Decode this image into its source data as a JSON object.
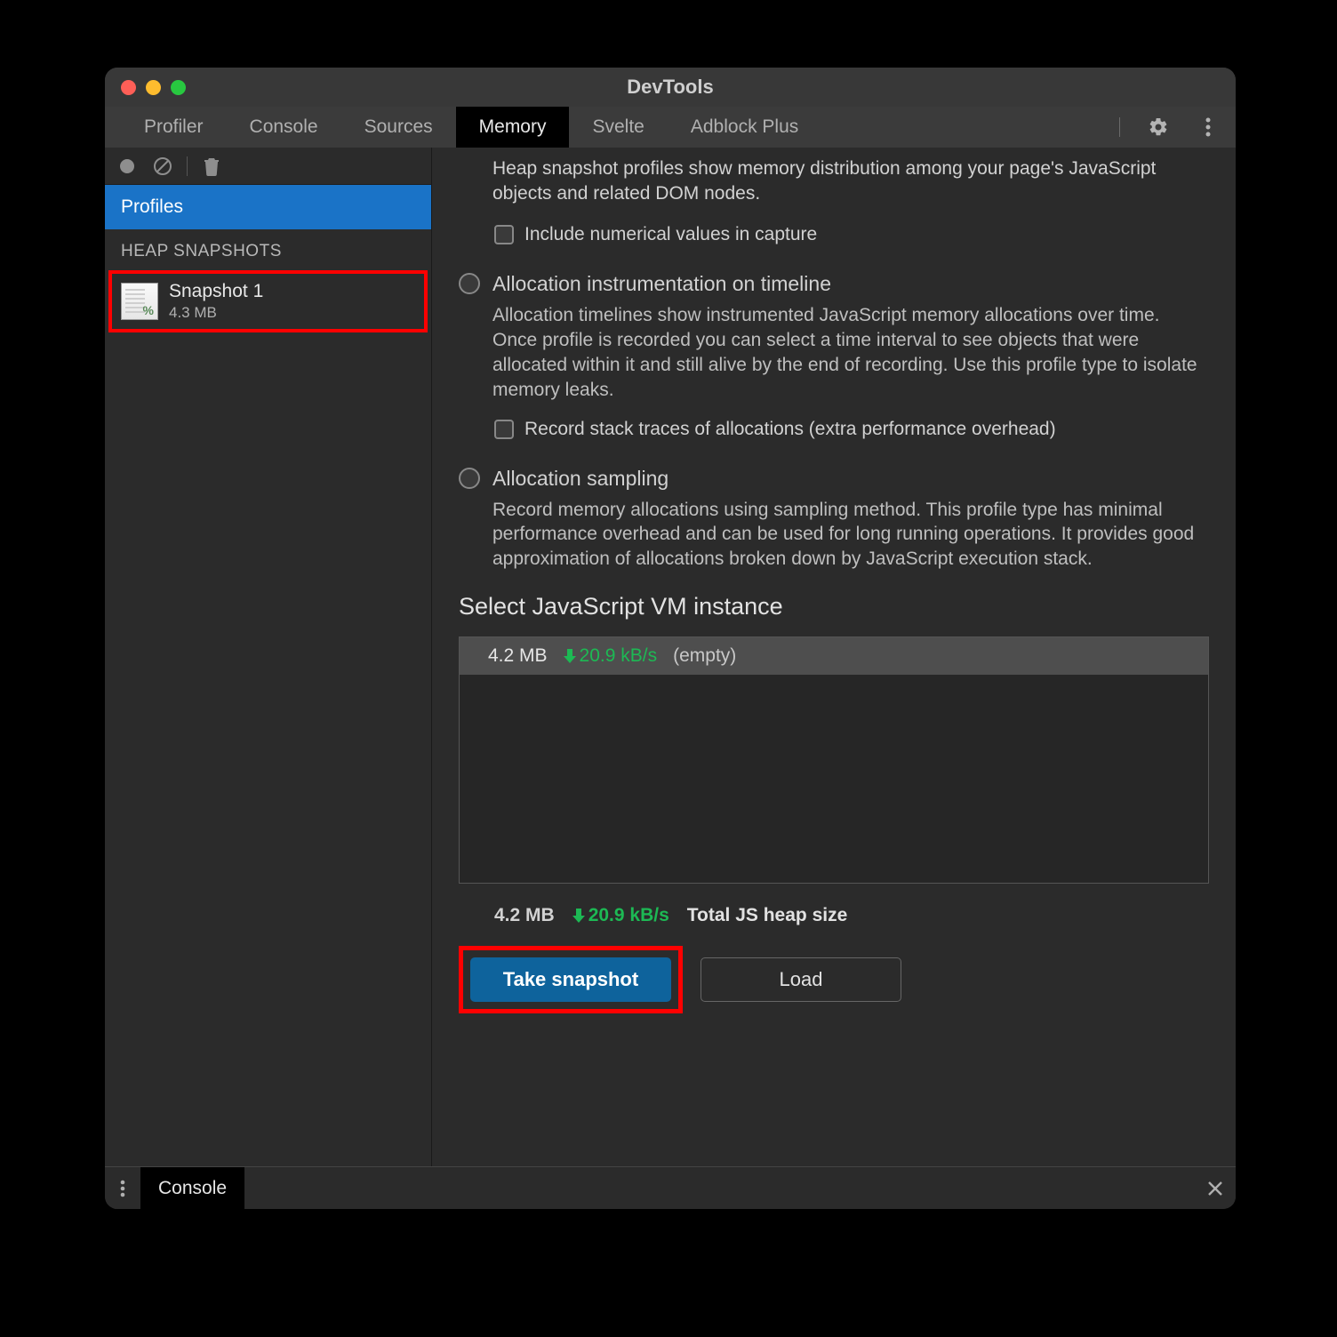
{
  "window": {
    "title": "DevTools"
  },
  "tabs": {
    "items": [
      "Profiler",
      "Console",
      "Sources",
      "Memory",
      "Svelte",
      "Adblock Plus"
    ],
    "active_index": 3
  },
  "toolbar": {
    "record_icon": "record",
    "clear_icon": "clear",
    "trash_icon": "trash"
  },
  "sidebar": {
    "tab_label": "Profiles",
    "section_label": "HEAP SNAPSHOTS",
    "snapshots": [
      {
        "title": "Snapshot 1",
        "size": "4.3 MB"
      }
    ]
  },
  "content": {
    "heap_desc": "Heap snapshot profiles show memory distribution among your page's JavaScript objects and related DOM nodes.",
    "heap_check_label": "Include numerical values in capture",
    "alloc_title": "Allocation instrumentation on timeline",
    "alloc_desc": "Allocation timelines show instrumented JavaScript memory allocations over time. Once profile is recorded you can select a time interval to see objects that were allocated within it and still alive by the end of recording. Use this profile type to isolate memory leaks.",
    "alloc_check_label": "Record stack traces of allocations (extra performance overhead)",
    "sampling_title": "Allocation sampling",
    "sampling_desc": "Record memory allocations using sampling method. This profile type has minimal performance overhead and can be used for long running operations. It provides good approximation of allocations broken down by JavaScript execution stack.",
    "vm_section_title": "Select JavaScript VM instance",
    "vm_row": {
      "size": "4.2 MB",
      "rate": "20.9 kB/s",
      "name": "(empty)"
    },
    "summary": {
      "size": "4.2 MB",
      "rate": "20.9 kB/s",
      "label": "Total JS heap size"
    },
    "take_label": "Take snapshot",
    "load_label": "Load"
  },
  "drawer": {
    "tab_label": "Console"
  }
}
